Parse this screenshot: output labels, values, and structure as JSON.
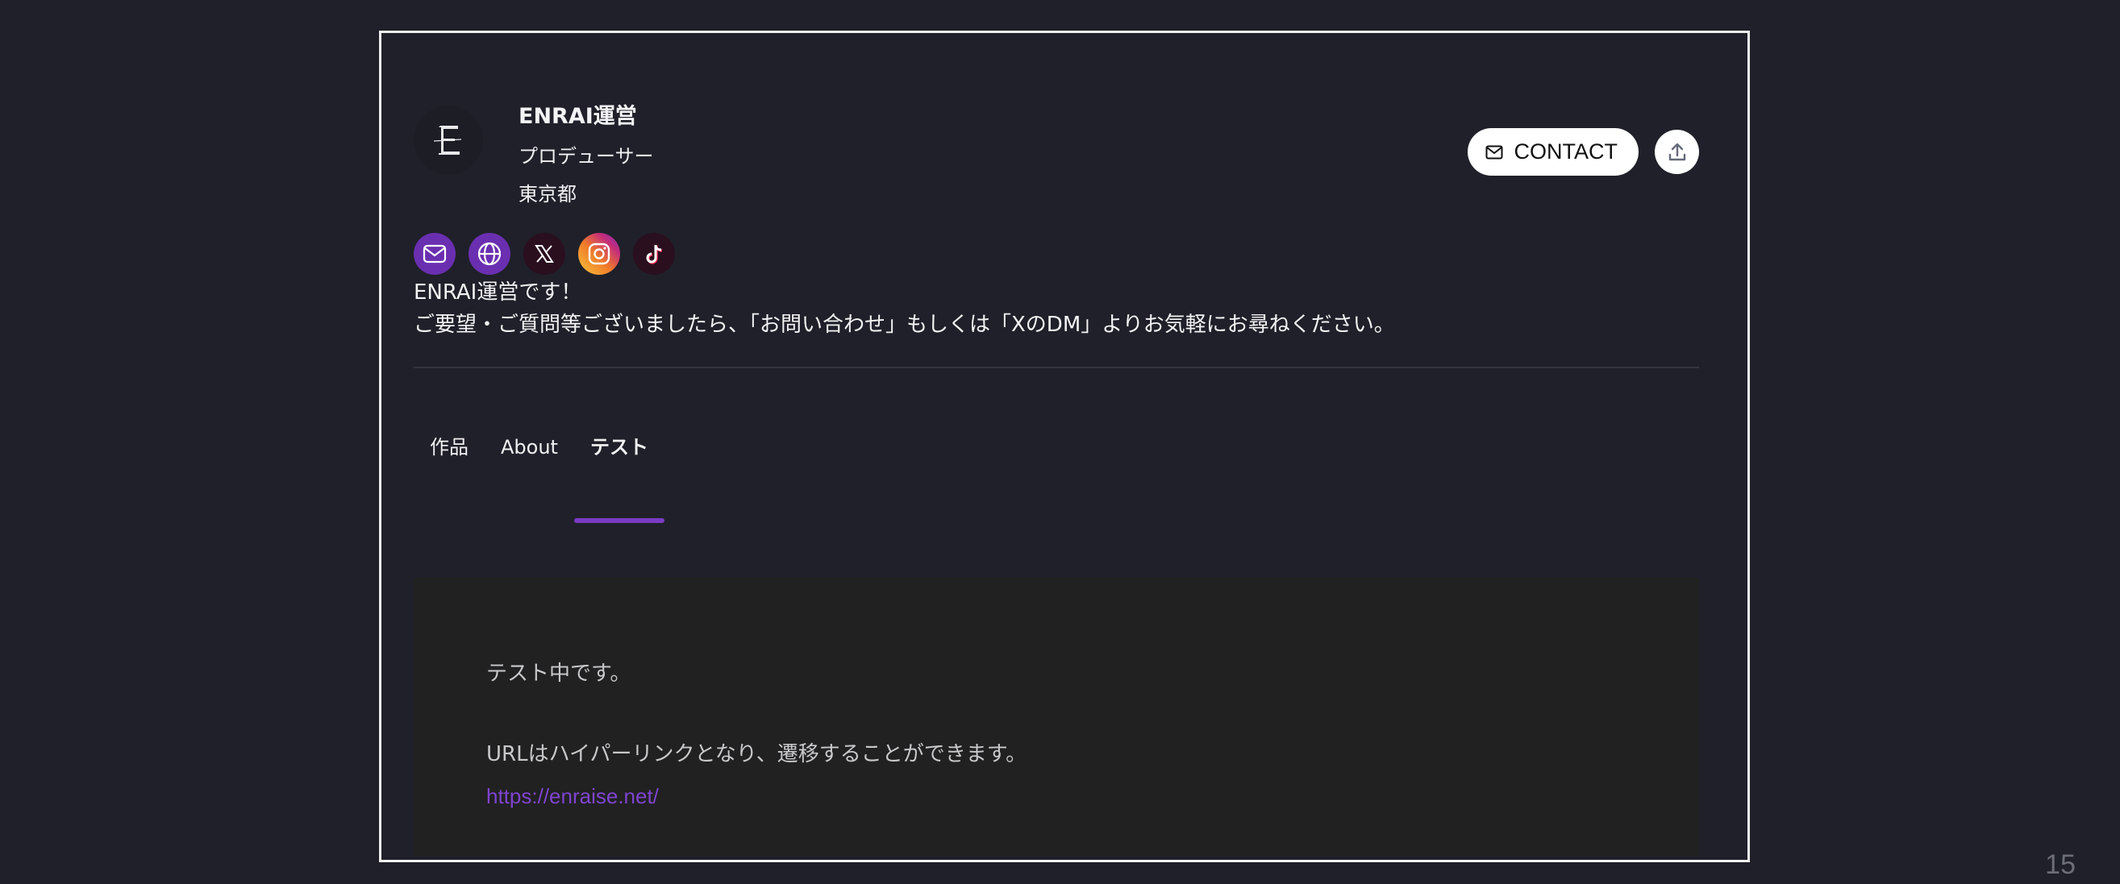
{
  "profile": {
    "avatar_letter": "E",
    "name": "ENRAI運営",
    "role": "プロデューサー",
    "location": "東京都"
  },
  "actions": {
    "contact_label": "CONTACT",
    "contact_icon": "mail-icon",
    "share_icon": "upload-icon"
  },
  "socials": [
    {
      "name": "mail",
      "color": "#6a2fb0"
    },
    {
      "name": "website",
      "color": "#6a2fb0"
    },
    {
      "name": "x",
      "color": "#2a0f1f"
    },
    {
      "name": "instagram",
      "color": "#f0b530"
    },
    {
      "name": "tiktok",
      "color": "#2a0f1f"
    }
  ],
  "bio": {
    "line1": "ENRAI運営です！",
    "line2": "ご要望・ご質問等ございましたら、「お問い合わせ」もしくは「XのDM」よりお気軽にお尋ねください。"
  },
  "tabs": [
    {
      "label": "作品",
      "active": false
    },
    {
      "label": "About",
      "active": false
    },
    {
      "label": "テスト",
      "active": true
    }
  ],
  "content": {
    "line1": "テスト中です。",
    "line2": "URLはハイパーリンクとなり、遷移することができます。",
    "link": "https://enraise.net/"
  },
  "page_number": "15",
  "colors": {
    "accent": "#7b3bc4",
    "background": "#1f2029",
    "panel": "#212121",
    "link": "#7f44d0"
  }
}
